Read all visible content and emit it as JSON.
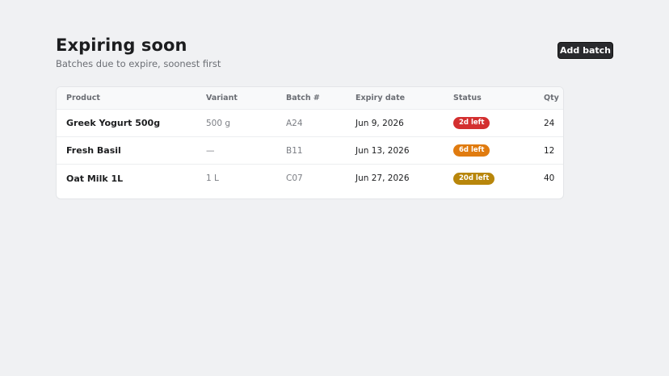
{
  "header": {
    "title": "Expiring soon",
    "subtitle": "Batches due to expire, soonest first",
    "add_button_label": "Add batch"
  },
  "table": {
    "columns": {
      "product": "Product",
      "variant": "Variant",
      "batch": "Batch #",
      "expiry": "Expiry date",
      "status": "Status",
      "qty": "Qty"
    },
    "rows": [
      {
        "product": "Greek Yogurt 500g",
        "variant": "500 g",
        "batch": "A24",
        "expiry": "Jun 9, 2026",
        "status": "2d left",
        "status_color": "#d32f2f",
        "qty": "24"
      },
      {
        "product": "Fresh Basil",
        "variant": "—",
        "batch": "B11",
        "expiry": "Jun 13, 2026",
        "status": "6d left",
        "status_color": "#e07b0f",
        "qty": "12"
      },
      {
        "product": "Oat Milk 1L",
        "variant": "1 L",
        "batch": "C07",
        "expiry": "Jun 27, 2026",
        "status": "20d left",
        "status_color": "#b8860b",
        "qty": "40"
      }
    ]
  }
}
